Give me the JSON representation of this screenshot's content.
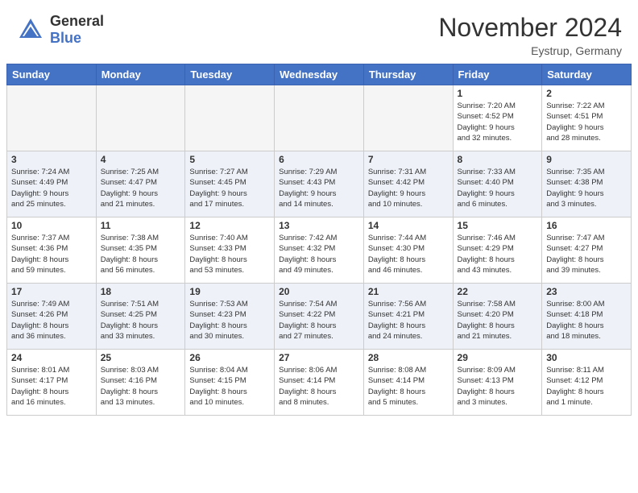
{
  "header": {
    "logo_general": "General",
    "logo_blue": "Blue",
    "month_title": "November 2024",
    "location": "Eystrup, Germany"
  },
  "days_of_week": [
    "Sunday",
    "Monday",
    "Tuesday",
    "Wednesday",
    "Thursday",
    "Friday",
    "Saturday"
  ],
  "weeks": [
    [
      {
        "day": "",
        "info": ""
      },
      {
        "day": "",
        "info": ""
      },
      {
        "day": "",
        "info": ""
      },
      {
        "day": "",
        "info": ""
      },
      {
        "day": "",
        "info": ""
      },
      {
        "day": "1",
        "info": "Sunrise: 7:20 AM\nSunset: 4:52 PM\nDaylight: 9 hours\nand 32 minutes."
      },
      {
        "day": "2",
        "info": "Sunrise: 7:22 AM\nSunset: 4:51 PM\nDaylight: 9 hours\nand 28 minutes."
      }
    ],
    [
      {
        "day": "3",
        "info": "Sunrise: 7:24 AM\nSunset: 4:49 PM\nDaylight: 9 hours\nand 25 minutes."
      },
      {
        "day": "4",
        "info": "Sunrise: 7:25 AM\nSunset: 4:47 PM\nDaylight: 9 hours\nand 21 minutes."
      },
      {
        "day": "5",
        "info": "Sunrise: 7:27 AM\nSunset: 4:45 PM\nDaylight: 9 hours\nand 17 minutes."
      },
      {
        "day": "6",
        "info": "Sunrise: 7:29 AM\nSunset: 4:43 PM\nDaylight: 9 hours\nand 14 minutes."
      },
      {
        "day": "7",
        "info": "Sunrise: 7:31 AM\nSunset: 4:42 PM\nDaylight: 9 hours\nand 10 minutes."
      },
      {
        "day": "8",
        "info": "Sunrise: 7:33 AM\nSunset: 4:40 PM\nDaylight: 9 hours\nand 6 minutes."
      },
      {
        "day": "9",
        "info": "Sunrise: 7:35 AM\nSunset: 4:38 PM\nDaylight: 9 hours\nand 3 minutes."
      }
    ],
    [
      {
        "day": "10",
        "info": "Sunrise: 7:37 AM\nSunset: 4:36 PM\nDaylight: 8 hours\nand 59 minutes."
      },
      {
        "day": "11",
        "info": "Sunrise: 7:38 AM\nSunset: 4:35 PM\nDaylight: 8 hours\nand 56 minutes."
      },
      {
        "day": "12",
        "info": "Sunrise: 7:40 AM\nSunset: 4:33 PM\nDaylight: 8 hours\nand 53 minutes."
      },
      {
        "day": "13",
        "info": "Sunrise: 7:42 AM\nSunset: 4:32 PM\nDaylight: 8 hours\nand 49 minutes."
      },
      {
        "day": "14",
        "info": "Sunrise: 7:44 AM\nSunset: 4:30 PM\nDaylight: 8 hours\nand 46 minutes."
      },
      {
        "day": "15",
        "info": "Sunrise: 7:46 AM\nSunset: 4:29 PM\nDaylight: 8 hours\nand 43 minutes."
      },
      {
        "day": "16",
        "info": "Sunrise: 7:47 AM\nSunset: 4:27 PM\nDaylight: 8 hours\nand 39 minutes."
      }
    ],
    [
      {
        "day": "17",
        "info": "Sunrise: 7:49 AM\nSunset: 4:26 PM\nDaylight: 8 hours\nand 36 minutes."
      },
      {
        "day": "18",
        "info": "Sunrise: 7:51 AM\nSunset: 4:25 PM\nDaylight: 8 hours\nand 33 minutes."
      },
      {
        "day": "19",
        "info": "Sunrise: 7:53 AM\nSunset: 4:23 PM\nDaylight: 8 hours\nand 30 minutes."
      },
      {
        "day": "20",
        "info": "Sunrise: 7:54 AM\nSunset: 4:22 PM\nDaylight: 8 hours\nand 27 minutes."
      },
      {
        "day": "21",
        "info": "Sunrise: 7:56 AM\nSunset: 4:21 PM\nDaylight: 8 hours\nand 24 minutes."
      },
      {
        "day": "22",
        "info": "Sunrise: 7:58 AM\nSunset: 4:20 PM\nDaylight: 8 hours\nand 21 minutes."
      },
      {
        "day": "23",
        "info": "Sunrise: 8:00 AM\nSunset: 4:18 PM\nDaylight: 8 hours\nand 18 minutes."
      }
    ],
    [
      {
        "day": "24",
        "info": "Sunrise: 8:01 AM\nSunset: 4:17 PM\nDaylight: 8 hours\nand 16 minutes."
      },
      {
        "day": "25",
        "info": "Sunrise: 8:03 AM\nSunset: 4:16 PM\nDaylight: 8 hours\nand 13 minutes."
      },
      {
        "day": "26",
        "info": "Sunrise: 8:04 AM\nSunset: 4:15 PM\nDaylight: 8 hours\nand 10 minutes."
      },
      {
        "day": "27",
        "info": "Sunrise: 8:06 AM\nSunset: 4:14 PM\nDaylight: 8 hours\nand 8 minutes."
      },
      {
        "day": "28",
        "info": "Sunrise: 8:08 AM\nSunset: 4:14 PM\nDaylight: 8 hours\nand 5 minutes."
      },
      {
        "day": "29",
        "info": "Sunrise: 8:09 AM\nSunset: 4:13 PM\nDaylight: 8 hours\nand 3 minutes."
      },
      {
        "day": "30",
        "info": "Sunrise: 8:11 AM\nSunset: 4:12 PM\nDaylight: 8 hours\nand 1 minute."
      }
    ]
  ]
}
